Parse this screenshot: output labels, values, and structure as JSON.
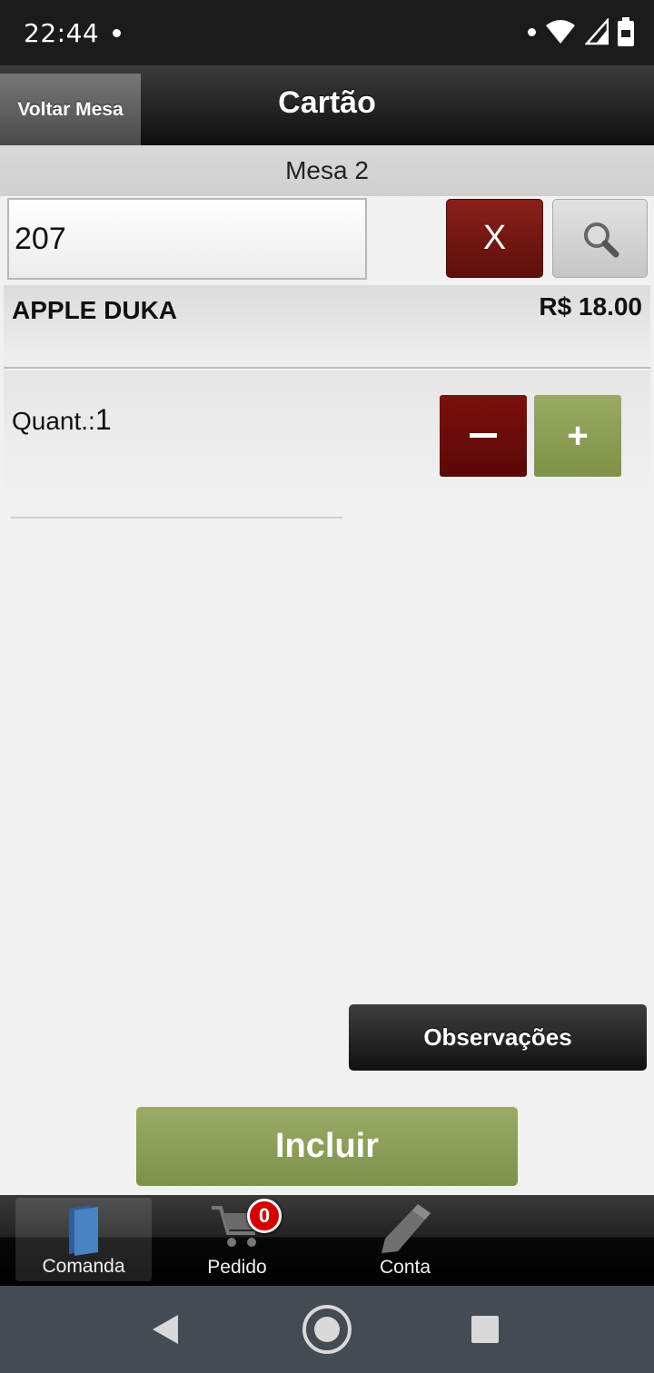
{
  "status_bar": {
    "time": "22:44",
    "icons": [
      "notification-dot-icon",
      "wifi-icon",
      "signal-icon",
      "battery-icon"
    ]
  },
  "header": {
    "back_label": "Voltar Mesa",
    "title": "Cartão"
  },
  "table_label": "Mesa 2",
  "search": {
    "value": "207",
    "clear_label": "X",
    "search_icon": "magnifier-icon"
  },
  "product": {
    "name": "APPLE DUKA",
    "price": "R$ 18.00"
  },
  "quantity": {
    "label": "Quant.:",
    "value": "1",
    "minus_label": "–",
    "plus_label": "+"
  },
  "observations_label": "Observações",
  "include_label": "Incluir",
  "tabs": [
    {
      "label": "Comanda",
      "icon": "folder-icon",
      "active": true
    },
    {
      "label": "Pedido",
      "icon": "cart-icon",
      "badge": "0"
    },
    {
      "label": "Conta",
      "icon": "pencil-icon"
    }
  ],
  "colors": {
    "danger": "#6b0d09",
    "success": "#8a9d55",
    "dark_bar": "#1b1b1b"
  }
}
